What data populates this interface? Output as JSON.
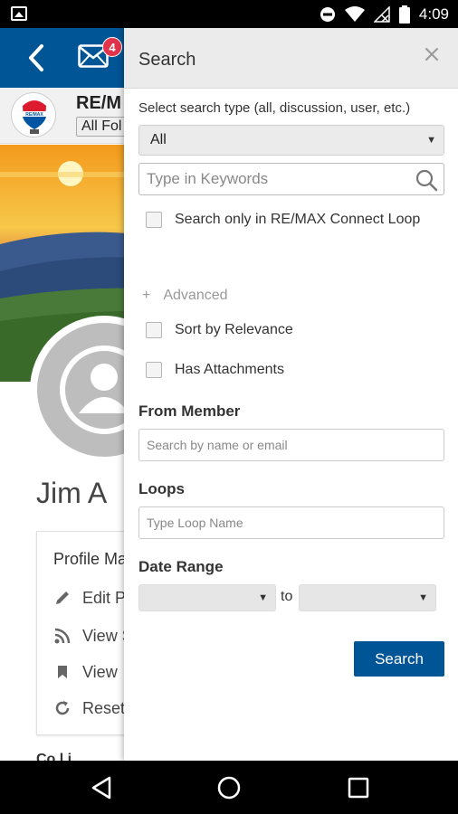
{
  "status_bar": {
    "time": "4:09"
  },
  "app": {
    "mail_badge_count": "4",
    "org_name": "RE/M",
    "folder_select": "All Fol",
    "user_name": "Jim A",
    "profile_card": {
      "title": "Profile Ma",
      "items": [
        {
          "icon": "pencil-icon",
          "label": "Edit P"
        },
        {
          "icon": "rss-icon",
          "label": "View S"
        },
        {
          "icon": "bookmark-icon",
          "label": "View"
        },
        {
          "icon": "refresh-icon",
          "label": "Reset"
        }
      ]
    },
    "bottom_cut_text": "Co  l  i"
  },
  "search_panel": {
    "title": "Search",
    "type_label": "Select search type (all, discussion, user, etc.)",
    "type_value": "All",
    "keywords_placeholder": "Type in Keywords",
    "only_loop_label": "Search only in RE/MAX Connect Loop",
    "advanced_label": "Advanced",
    "sort_relevance_label": "Sort by Relevance",
    "has_attachments_label": "Has Attachments",
    "from_member_label": "From Member",
    "member_placeholder": "Search by name or email",
    "loops_label": "Loops",
    "loops_placeholder": "Type Loop Name",
    "date_range_label": "Date Range",
    "date_from_value": "",
    "to_label": "to",
    "date_to_value": "",
    "search_button": "Search"
  },
  "colors": {
    "brand_blue": "#005596",
    "badge_red": "#e2334a"
  }
}
